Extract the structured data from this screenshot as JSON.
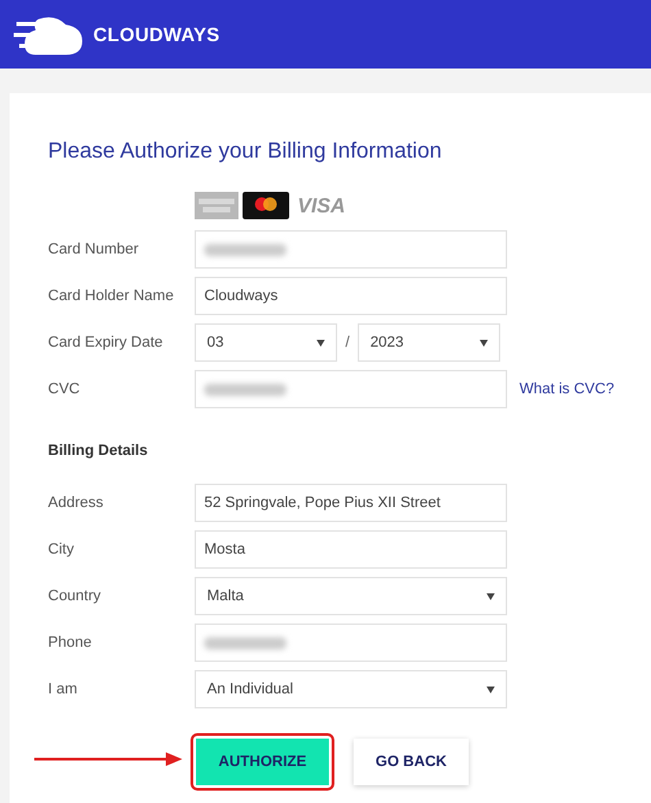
{
  "header": {
    "brand": "CLOUDWAYS"
  },
  "title": "Please Authorize your Billing Information",
  "card_brands": {
    "visa": "VISA"
  },
  "card_fields": [
    {
      "label": "Card Number",
      "kind": "redacted"
    },
    {
      "label": "Card Holder Name",
      "kind": "text",
      "value": "Cloudways"
    },
    {
      "label": "Card Expiry Date",
      "kind": "expiry",
      "month": "03",
      "separator": "/",
      "year": "2023"
    },
    {
      "label": "CVC",
      "kind": "redacted",
      "link": "What is CVC?"
    }
  ],
  "billing_heading": "Billing Details",
  "billing_fields": [
    {
      "label": "Address",
      "kind": "text",
      "value": "52 Springvale, Pope Pius XII Street"
    },
    {
      "label": "City",
      "kind": "text",
      "value": "Mosta"
    },
    {
      "label": "Country",
      "kind": "select",
      "value": "Malta"
    },
    {
      "label": "Phone",
      "kind": "redacted"
    },
    {
      "label": "I am",
      "kind": "select",
      "value": "An Individual"
    }
  ],
  "buttons": [
    {
      "label": "AUTHORIZE",
      "kind": "primary",
      "highlighted": true
    },
    {
      "label": "GO BACK",
      "kind": "secondary",
      "highlighted": false
    }
  ]
}
